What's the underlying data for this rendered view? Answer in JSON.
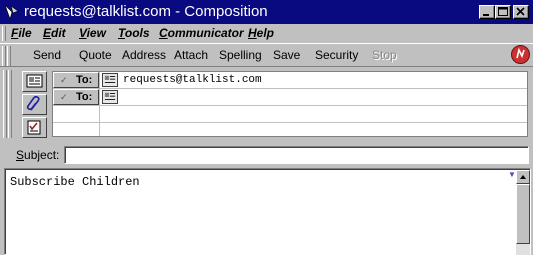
{
  "window": {
    "title": "requests@talklist.com - Composition",
    "icons": {
      "app": "netscape-composer-icon",
      "minimize": "minimize-icon",
      "maximize": "maximize-icon",
      "close": "close-icon"
    }
  },
  "menubar": {
    "items": [
      {
        "label": "File",
        "mnemonic": "F"
      },
      {
        "label": "Edit",
        "mnemonic": "E"
      },
      {
        "label": "View",
        "mnemonic": "V"
      },
      {
        "label": "Tools",
        "mnemonic": "T"
      },
      {
        "label": "Communicator",
        "mnemonic": "C"
      },
      {
        "label": "Help",
        "mnemonic": "H"
      }
    ]
  },
  "toolbar": {
    "items": [
      "Send",
      "Quote",
      "Address",
      "Attach",
      "Spelling",
      "Save",
      "Security",
      "Stop"
    ],
    "disabled": [
      "Stop"
    ],
    "brand_icon": "netscape-throbber-icon"
  },
  "address_tabs": [
    "address-card-icon",
    "paperclip-icon",
    "message-options-icon"
  ],
  "recipients": [
    {
      "type": "To:",
      "value": "requests@talklist.com"
    },
    {
      "type": "To:",
      "value": ""
    }
  ],
  "subject": {
    "label": "Subject:",
    "value": ""
  },
  "body": {
    "text": "Subscribe Children"
  },
  "colors": {
    "titlebar": "#0a0a80",
    "chrome": "#c0c0c0",
    "netscape_red": "#c83232"
  }
}
